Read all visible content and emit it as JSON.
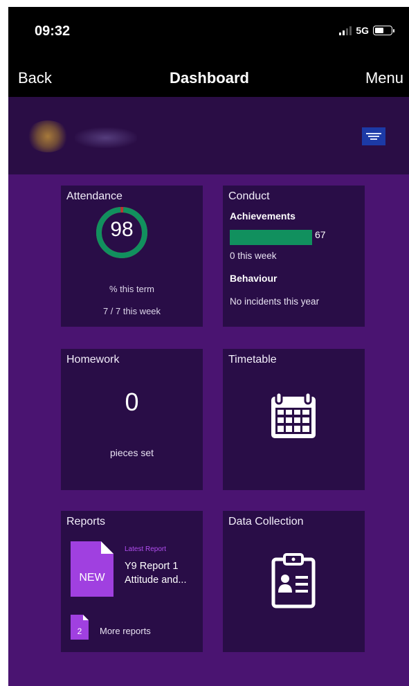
{
  "status_bar": {
    "time": "09:32",
    "network": "5G"
  },
  "nav": {
    "back_label": "Back",
    "title": "Dashboard",
    "menu_label": "Menu"
  },
  "profile": {
    "logo_icon": "school-crest-icon"
  },
  "attendance": {
    "title": "Attendance",
    "percent": "98",
    "percent_value": 98,
    "term_label": "% this term",
    "week_label": "7 / 7 this week",
    "ring_color": "#11905e",
    "gap_color": "#c23232"
  },
  "conduct": {
    "title": "Conduct",
    "achievements_label": "Achievements",
    "achievements_count": "67",
    "achievements_bar_fraction": 0.85,
    "achievements_week": "0 this week",
    "behaviour_label": "Behaviour",
    "behaviour_text": "No incidents this year",
    "bar_color": "#11905e"
  },
  "homework": {
    "title": "Homework",
    "count": "0",
    "label": "pieces set"
  },
  "timetable": {
    "title": "Timetable",
    "icon": "calendar-icon"
  },
  "reports": {
    "title": "Reports",
    "new_badge": "NEW",
    "latest_label": "Latest Report",
    "latest_title": "Y9 Report 1 Attitude and...",
    "more_count": "2",
    "more_label": "More reports",
    "accent": "#a040e0"
  },
  "data_collection": {
    "title": "Data Collection",
    "icon": "clipboard-icon"
  }
}
